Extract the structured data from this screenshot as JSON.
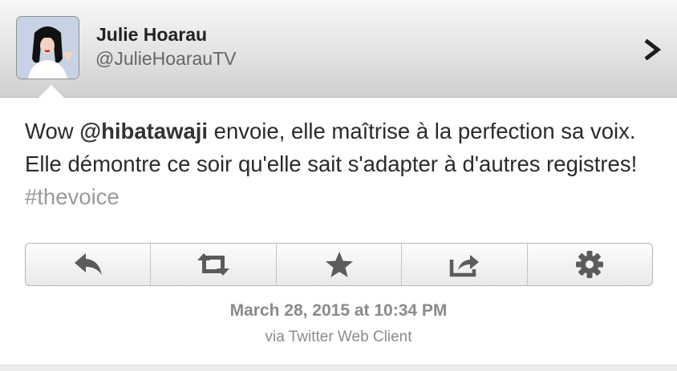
{
  "author": {
    "name": "Julie Hoarau",
    "handle": "@JulieHoarauTV",
    "avatar_icon": "profile-photo"
  },
  "tweet": {
    "prefix": "Wow ",
    "mention": "@hibatawaji",
    "body": " envoie, elle maîtrise à la perfection sa voix. Elle démontre ce soir qu'elle sait s'adapter à d'autres registres! ",
    "hashtag": "#thevoice"
  },
  "actions": [
    {
      "icon": "reply-icon"
    },
    {
      "icon": "retweet-icon"
    },
    {
      "icon": "star-icon"
    },
    {
      "icon": "share-icon"
    },
    {
      "icon": "gear-icon"
    }
  ],
  "meta": {
    "timestamp": "March 28, 2015 at 10:34 PM",
    "client": "via Twitter Web Client"
  },
  "colors": {
    "icon": "#5b5b5b",
    "hashtag": "#9a9a9a",
    "meta_text": "#8a8a8a"
  }
}
